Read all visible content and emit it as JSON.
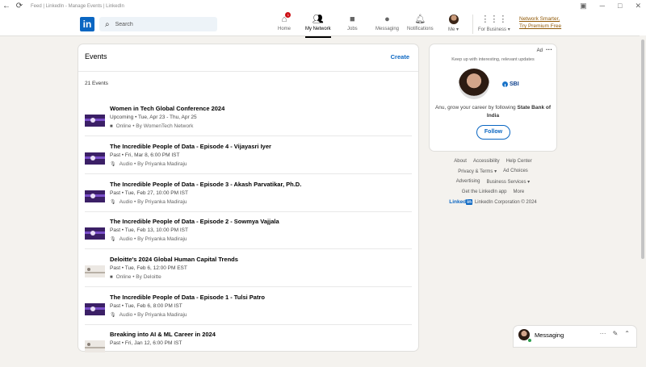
{
  "window": {
    "title": "Feed | LinkedIn - Manage Events | LinkedIn",
    "back_icon": "back-arrow-icon",
    "reload_icon": "reload-icon"
  },
  "nav": {
    "search_placeholder": "Search",
    "items": [
      {
        "label": "Home",
        "icon": "home-icon",
        "badge": "1"
      },
      {
        "label": "My Network",
        "icon": "network-icon",
        "active": true
      },
      {
        "label": "Jobs",
        "icon": "briefcase-icon"
      },
      {
        "label": "Messaging",
        "icon": "chat-icon"
      },
      {
        "label": "Notifications",
        "icon": "bell-icon"
      },
      {
        "label": "Me",
        "icon": "avatar"
      },
      {
        "label": "For Business",
        "icon": "grid-icon"
      }
    ],
    "premium_line1": "Network Smarter,",
    "premium_line2": "Try Premium Free"
  },
  "events_panel": {
    "heading": "Events",
    "create_label": "Create",
    "count_label": "21 Events",
    "events": [
      {
        "title": "Women in Tech Global Conference 2024",
        "date": "Upcoming • Tue, Apr 23 - Thu, Apr 25",
        "meta": "Online • By WomenTech Network",
        "meta_icon": "video-icon"
      },
      {
        "title": "The Incredible People of Data - Episode 4 - Vijayasri Iyer",
        "date": "Past • Fri, Mar 8, 6:00 PM IST",
        "meta": "Audio • By Priyanka Madiraju",
        "meta_icon": "mic-icon"
      },
      {
        "title": "The Incredible People of Data - Episode 3 - Akash Parvatikar, Ph.D.",
        "date": "Past • Tue, Feb 27, 10:00 PM IST",
        "meta": "Audio • By Priyanka Madiraju",
        "meta_icon": "mic-icon"
      },
      {
        "title": "The Incredible People of Data - Episode 2 - Sowmya Vajjala",
        "date": "Past • Tue, Feb 13, 10:00 PM IST",
        "meta": "Audio • By Priyanka Madiraju",
        "meta_icon": "mic-icon"
      },
      {
        "title": "Deloitte's 2024 Global Human Capital Trends",
        "date": "Past • Tue, Feb 6, 12:00 PM EST",
        "meta": "Online • By Deloitte",
        "meta_icon": "video-icon"
      },
      {
        "title": "The Incredible People of Data - Episode 1 - Tulsi Patro",
        "date": "Past • Tue, Feb 6, 8:00 PM IST",
        "meta": "Audio • By Priyanka Madiraju",
        "meta_icon": "mic-icon"
      },
      {
        "title": "Breaking into AI & ML Career in 2024",
        "date": "Past • Fri, Jan 12, 6:00 PM IST",
        "meta": "",
        "meta_icon": "video-icon"
      }
    ]
  },
  "ad": {
    "label": "Ad",
    "tagline": "Keep up with interesting, relevant updates",
    "company": "SBI",
    "message_prefix": "Anu, grow your career by following ",
    "message_company": "State Bank of India",
    "follow_label": "Follow"
  },
  "footer": {
    "row1": [
      "About",
      "Accessibility",
      "Help Center"
    ],
    "row2": [
      "Privacy & Terms ▾",
      "Ad Choices"
    ],
    "row3": [
      "Advertising",
      "Business Services ▾"
    ],
    "row4": [
      "Get the LinkedIn app",
      "More"
    ],
    "brand": "Linked",
    "brand_in": "in",
    "copyright": "LinkedIn Corporation © 2024"
  },
  "messaging": {
    "label": "Messaging"
  }
}
